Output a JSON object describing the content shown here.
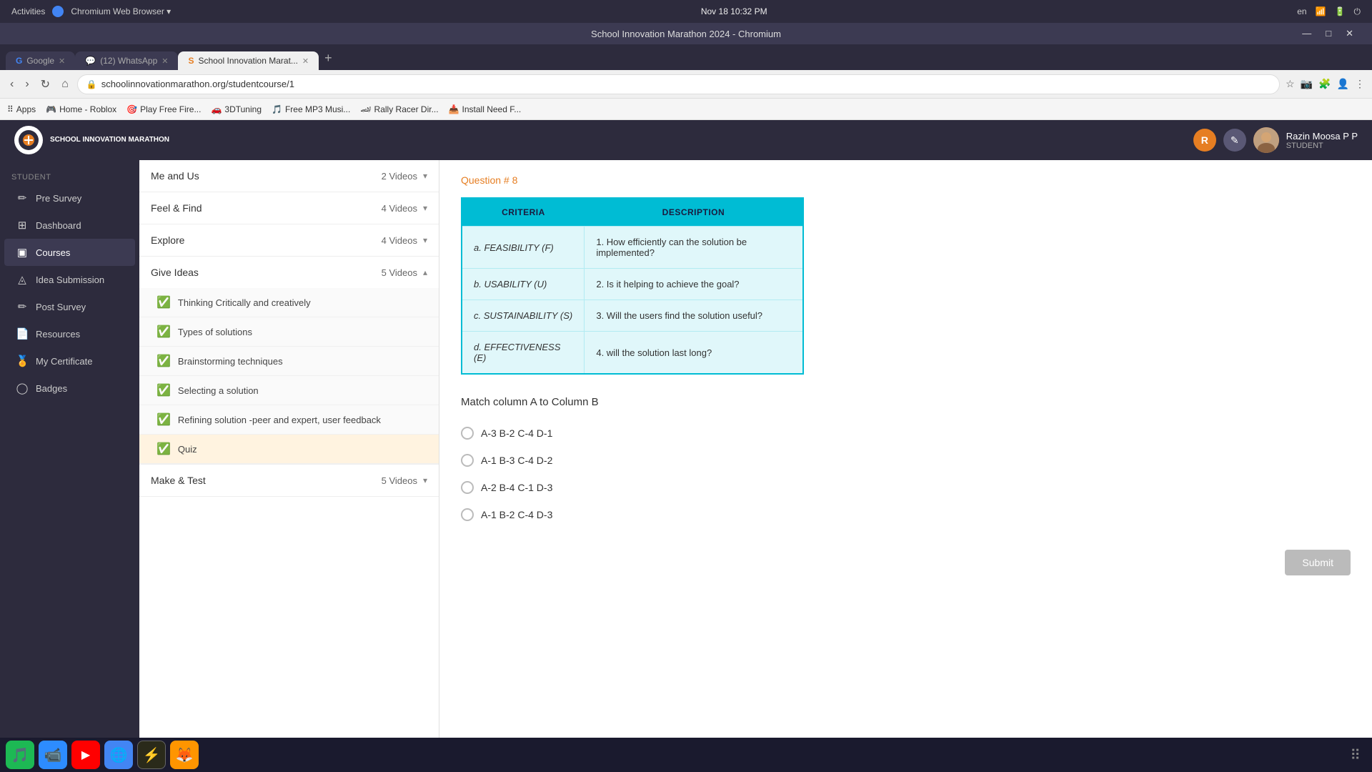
{
  "browser": {
    "title": "School Innovation Marathon 2024 - Chromium",
    "datetime": "Nov 18  10:32 PM",
    "language": "en",
    "tabs": [
      {
        "label": "Google",
        "active": false,
        "favicon": "G"
      },
      {
        "label": "(12) WhatsApp",
        "active": false,
        "favicon": "W"
      },
      {
        "label": "School Innovation Marat...",
        "active": true,
        "favicon": "S"
      }
    ],
    "url": "schoolinnovationmarathon.org/studentcourse/1",
    "bookmarks": [
      {
        "label": "Apps"
      },
      {
        "label": "Home - Roblox"
      },
      {
        "label": "Play Free Fire..."
      },
      {
        "label": "3DTuning"
      },
      {
        "label": "Free MP3 Musi..."
      },
      {
        "label": "Rally Racer Dir..."
      },
      {
        "label": "Install Need F..."
      }
    ]
  },
  "app": {
    "logo_text": "SCHOOL INNOVATION MARATHON",
    "user_name": "Razin Moosa P P",
    "user_role": "STUDENT",
    "header_icon1": "R",
    "header_icon2": "✎"
  },
  "sidebar": {
    "section_label": "Student",
    "items": [
      {
        "label": "Pre Survey",
        "icon": "✏",
        "active": false
      },
      {
        "label": "Dashboard",
        "icon": "⊞",
        "active": false
      },
      {
        "label": "Courses",
        "icon": "▣",
        "active": true
      },
      {
        "label": "Idea Submission",
        "icon": "◬",
        "active": false
      },
      {
        "label": "Post Survey",
        "icon": "✏",
        "active": false
      },
      {
        "label": "Resources",
        "icon": "📄",
        "active": false
      },
      {
        "label": "My Certificate",
        "icon": "🏅",
        "active": false
      },
      {
        "label": "Badges",
        "icon": "◯",
        "active": false
      }
    ]
  },
  "course_sections": [
    {
      "title": "Me and Us",
      "videos": "2 Videos",
      "expanded": false,
      "items": []
    },
    {
      "title": "Feel & Find",
      "videos": "4 Videos",
      "expanded": false,
      "items": []
    },
    {
      "title": "Explore",
      "videos": "4 Videos",
      "expanded": false,
      "items": []
    },
    {
      "title": "Give Ideas",
      "videos": "5 Videos",
      "expanded": true,
      "items": [
        {
          "label": "Thinking Critically and creatively",
          "completed": true,
          "active": false
        },
        {
          "label": "Types of solutions",
          "completed": true,
          "active": false
        },
        {
          "label": "Brainstorming techniques",
          "completed": true,
          "active": false
        },
        {
          "label": "Selecting a solution",
          "completed": true,
          "active": false
        },
        {
          "label": "Refining solution -peer and expert, user feedback",
          "completed": true,
          "active": false
        },
        {
          "label": "Quiz",
          "completed": true,
          "active": true
        }
      ]
    },
    {
      "title": "Make & Test",
      "videos": "5 Videos",
      "expanded": false,
      "items": []
    }
  ],
  "content": {
    "question_label": "Question # 8",
    "table": {
      "col1_header": "CRITERIA",
      "col2_header": "DESCRIPTION",
      "rows": [
        {
          "criteria": "a. FEASIBILITY (F)",
          "description": "1. How efficiently can the solution be implemented?"
        },
        {
          "criteria": "b. USABILITY (U)",
          "description": "2. Is it helping to achieve the goal?"
        },
        {
          "criteria": "c. SUSTAINABILITY (S)",
          "description": "3. Will the users find the solution useful?"
        },
        {
          "criteria": "d. EFFECTIVENESS (E)",
          "description": "4. will the solution last long?"
        }
      ]
    },
    "match_title": "Match column A to Column B",
    "options": [
      {
        "label": "A-3 B-2 C-4 D-1",
        "selected": false
      },
      {
        "label": "A-1 B-3 C-4 D-2",
        "selected": false
      },
      {
        "label": "A-2 B-4 C-1 D-3",
        "selected": false
      },
      {
        "label": "A-1 B-2 C-4 D-3",
        "selected": false
      }
    ],
    "submit_label": "Submit"
  },
  "taskbar": {
    "apps": [
      {
        "name": "Spotify",
        "color": "#1DB954",
        "icon": "🎵"
      },
      {
        "name": "Zoom",
        "color": "#2D8CFF",
        "icon": "📹"
      },
      {
        "name": "YouTube",
        "color": "#FF0000",
        "icon": "▶"
      },
      {
        "name": "Chromium",
        "color": "#4285F4",
        "icon": "🌐"
      },
      {
        "name": "Clash",
        "color": "#FF6B35",
        "icon": "⚡"
      },
      {
        "name": "Firefox",
        "color": "#FF9500",
        "icon": "🦊"
      }
    ]
  }
}
